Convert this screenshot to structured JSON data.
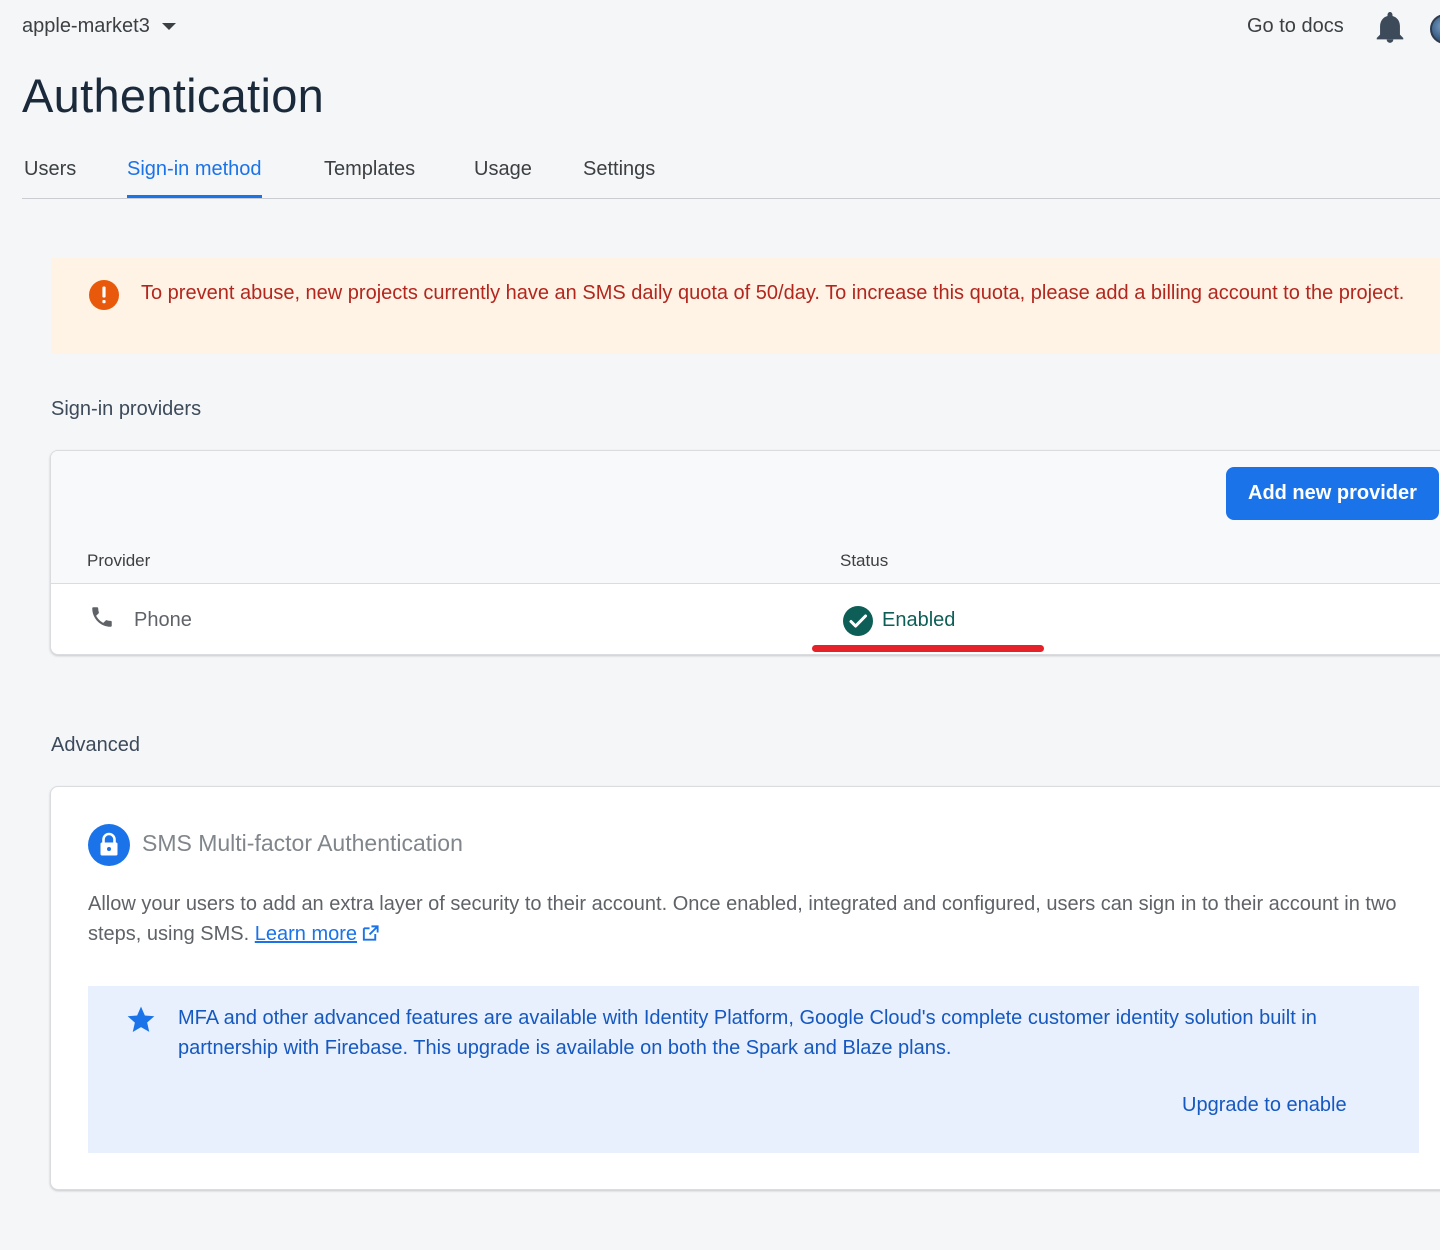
{
  "header": {
    "project_name": "apple-market3",
    "docs_label": "Go to docs"
  },
  "page": {
    "title": "Authentication"
  },
  "tabs": [
    {
      "label": "Users",
      "active": false
    },
    {
      "label": "Sign-in method",
      "active": true
    },
    {
      "label": "Templates",
      "active": false
    },
    {
      "label": "Usage",
      "active": false
    },
    {
      "label": "Settings",
      "active": false
    }
  ],
  "warning": {
    "text": "To prevent abuse, new projects currently have an SMS daily quota of 50/day. To increase this quota, please add a billing account to the project.",
    "icon": "error-icon"
  },
  "providers": {
    "heading": "Sign-in providers",
    "add_button": "Add new provider",
    "columns": [
      "Provider",
      "Status"
    ],
    "rows": [
      {
        "name": "Phone",
        "icon": "phone-icon",
        "status": "Enabled"
      }
    ]
  },
  "advanced": {
    "heading": "Advanced",
    "mfa_title": "SMS Multi-factor Authentication",
    "mfa_description": "Allow your users to add an extra layer of security to their account. Once enabled, integrated and configured, users can sign in to their account in two steps, using SMS.",
    "learn_more": "Learn more",
    "upgrade_text": "MFA and other advanced features are available with Identity Platform, Google Cloud's complete customer identity solution built in partnership with Firebase. This upgrade is available on both the Spark and Blaze plans.",
    "upgrade_button": "Upgrade to enable"
  },
  "colors": {
    "accent": "#1a73e8",
    "warning_bg": "#fef3e5",
    "warning_text": "#b3261e",
    "enabled_green": "#0d5e57",
    "annotation_red": "#e5212a",
    "upgrade_bg": "#e8f0fe"
  }
}
